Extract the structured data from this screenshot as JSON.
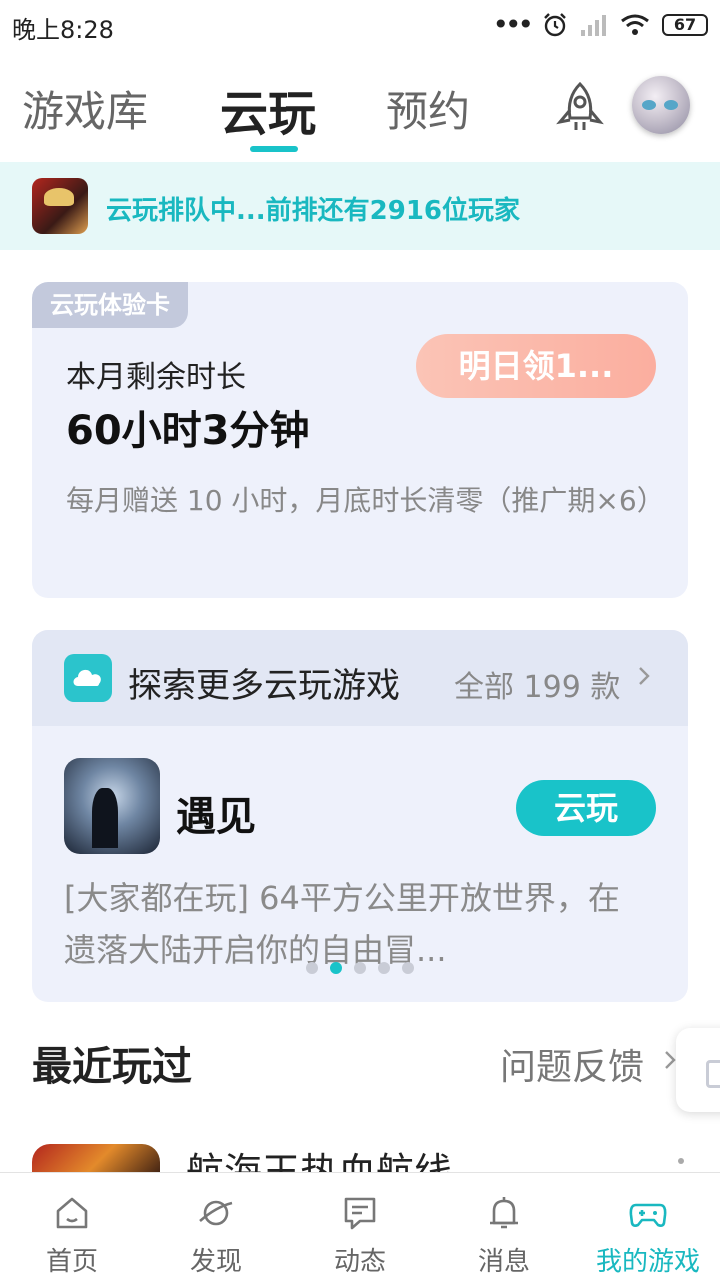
{
  "status_bar": {
    "time": "晚上8:28",
    "battery": "67"
  },
  "top_tabs": {
    "items": [
      {
        "label": "游戏库"
      },
      {
        "label": "云玩"
      },
      {
        "label": "预约"
      }
    ],
    "active": "云玩",
    "icons": [
      "rocket-icon",
      "avatar"
    ]
  },
  "queue_banner": {
    "text": "云玩排队中...前排还有2916位玩家"
  },
  "experience_card": {
    "tag": "云玩体验卡",
    "label": "本月剩余时长",
    "value": "60小时3分钟",
    "claim_button": "明日领1...",
    "description": "每月赠送 10 小时，月底时长清零（推广期×6）"
  },
  "explore_card": {
    "title": "探索更多云玩游戏",
    "count": "全部 199 款",
    "game_name": "遇见",
    "play_button": "云玩",
    "game_description": "[大家都在玩] 64平方公里开放世界，在遗落大陆开启你的自由冒...",
    "pager": {
      "count": 5,
      "active_index": 1
    }
  },
  "recent": {
    "title": "最近玩过",
    "feedback": "问题反馈",
    "first_game_name": "航海王热血航线"
  },
  "bottom_nav": {
    "items": [
      {
        "label": "首页",
        "icon": "home-icon"
      },
      {
        "label": "发现",
        "icon": "planet-icon"
      },
      {
        "label": "动态",
        "icon": "chat-icon"
      },
      {
        "label": "消息",
        "icon": "bell-icon"
      },
      {
        "label": "我的游戏",
        "icon": "gamepad-icon"
      }
    ],
    "active": "我的游戏"
  },
  "colors": {
    "accent": "#19c3c9",
    "banner_bg": "#e6f8f8",
    "card_bg": "#eef1fb",
    "claim_gradient": "#fbb4a4"
  }
}
